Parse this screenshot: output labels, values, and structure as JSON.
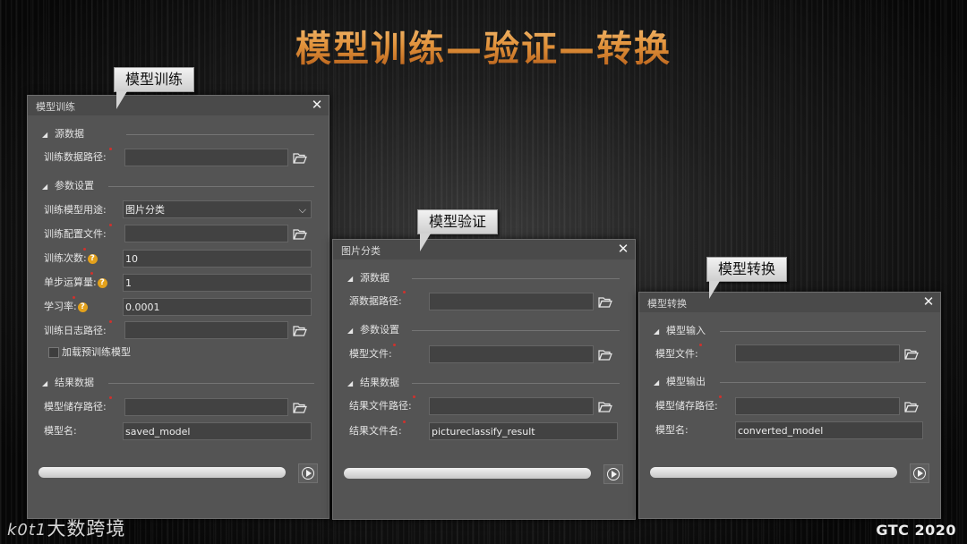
{
  "slide": {
    "title": "模型训练—验证—转换",
    "footer_left": "大数跨境",
    "footer_left_mark": "k0t1",
    "footer_right": "GTC 2020"
  },
  "callouts": {
    "train": "模型训练",
    "validate": "模型验证",
    "convert": "模型转换"
  },
  "train_dialog": {
    "title": "模型训练",
    "close": "✕",
    "section_source": "源数据",
    "section_params": "参数设置",
    "section_result": "结果数据",
    "train_path_label": "训练数据路径:",
    "train_path_value": "",
    "purpose_label": "训练模型用途:",
    "purpose_value": "图片分类",
    "config_label": "训练配置文件:",
    "config_value": "",
    "epochs_label": "训练次数:",
    "epochs_value": "10",
    "batch_label": "单步运算量:",
    "batch_value": "1",
    "lr_label": "学习率:",
    "lr_value": "0.0001",
    "log_label": "训练日志路径:",
    "log_value": "",
    "pretrained_label": "加载预训练模型",
    "pretrained_checked": false,
    "save_path_label": "模型储存路径:",
    "save_path_value": "",
    "model_name_label": "模型名:",
    "model_name_value": "saved_model",
    "help_glyph": "?",
    "progress": 0
  },
  "validate_dialog": {
    "title": "图片分类",
    "close": "✕",
    "section_source": "源数据",
    "section_params": "参数设置",
    "section_result": "结果数据",
    "source_path_label": "源数据路径:",
    "source_path_value": "",
    "model_file_label": "模型文件:",
    "model_file_value": "",
    "result_path_label": "结果文件路径:",
    "result_path_value": "",
    "result_name_label": "结果文件名:",
    "result_name_value": "pictureclassify_result",
    "progress": 0
  },
  "convert_dialog": {
    "title": "模型转换",
    "close": "✕",
    "section_input": "模型输入",
    "section_output": "模型输出",
    "model_file_label": "模型文件:",
    "model_file_value": "",
    "save_path_label": "模型储存路径:",
    "save_path_value": "",
    "model_name_label": "模型名:",
    "model_name_value": "converted_model",
    "progress": 0
  },
  "icons": {
    "folder": "folder-open-icon",
    "close": "close-icon",
    "run": "play-circle-icon",
    "help": "question-circle-icon",
    "dropdown": "chevron-down-icon",
    "section": "triangle-down-icon"
  },
  "colors": {
    "title_orange": "#e0913a",
    "dialog_bg": "#545454",
    "field_bg": "#424242",
    "required_red": "#d0312d",
    "help_yellow": "#e3a11c"
  }
}
